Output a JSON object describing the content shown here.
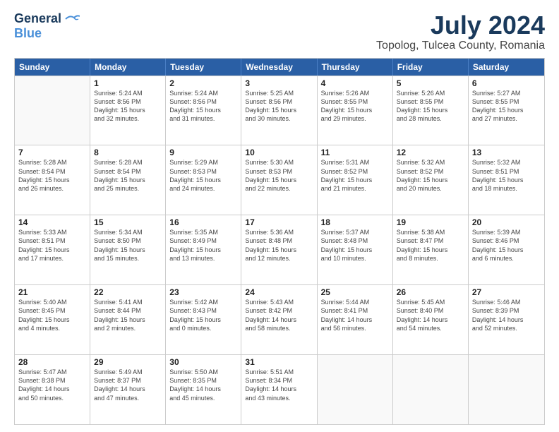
{
  "logo": {
    "line1": "General",
    "line2": "Blue"
  },
  "title": "July 2024",
  "subtitle": "Topolog, Tulcea County, Romania",
  "header": {
    "days": [
      "Sunday",
      "Monday",
      "Tuesday",
      "Wednesday",
      "Thursday",
      "Friday",
      "Saturday"
    ]
  },
  "weeks": [
    [
      {
        "day": "",
        "info": ""
      },
      {
        "day": "1",
        "info": "Sunrise: 5:24 AM\nSunset: 8:56 PM\nDaylight: 15 hours\nand 32 minutes."
      },
      {
        "day": "2",
        "info": "Sunrise: 5:24 AM\nSunset: 8:56 PM\nDaylight: 15 hours\nand 31 minutes."
      },
      {
        "day": "3",
        "info": "Sunrise: 5:25 AM\nSunset: 8:56 PM\nDaylight: 15 hours\nand 30 minutes."
      },
      {
        "day": "4",
        "info": "Sunrise: 5:26 AM\nSunset: 8:55 PM\nDaylight: 15 hours\nand 29 minutes."
      },
      {
        "day": "5",
        "info": "Sunrise: 5:26 AM\nSunset: 8:55 PM\nDaylight: 15 hours\nand 28 minutes."
      },
      {
        "day": "6",
        "info": "Sunrise: 5:27 AM\nSunset: 8:55 PM\nDaylight: 15 hours\nand 27 minutes."
      }
    ],
    [
      {
        "day": "7",
        "info": "Sunrise: 5:28 AM\nSunset: 8:54 PM\nDaylight: 15 hours\nand 26 minutes."
      },
      {
        "day": "8",
        "info": "Sunrise: 5:28 AM\nSunset: 8:54 PM\nDaylight: 15 hours\nand 25 minutes."
      },
      {
        "day": "9",
        "info": "Sunrise: 5:29 AM\nSunset: 8:53 PM\nDaylight: 15 hours\nand 24 minutes."
      },
      {
        "day": "10",
        "info": "Sunrise: 5:30 AM\nSunset: 8:53 PM\nDaylight: 15 hours\nand 22 minutes."
      },
      {
        "day": "11",
        "info": "Sunrise: 5:31 AM\nSunset: 8:52 PM\nDaylight: 15 hours\nand 21 minutes."
      },
      {
        "day": "12",
        "info": "Sunrise: 5:32 AM\nSunset: 8:52 PM\nDaylight: 15 hours\nand 20 minutes."
      },
      {
        "day": "13",
        "info": "Sunrise: 5:32 AM\nSunset: 8:51 PM\nDaylight: 15 hours\nand 18 minutes."
      }
    ],
    [
      {
        "day": "14",
        "info": "Sunrise: 5:33 AM\nSunset: 8:51 PM\nDaylight: 15 hours\nand 17 minutes."
      },
      {
        "day": "15",
        "info": "Sunrise: 5:34 AM\nSunset: 8:50 PM\nDaylight: 15 hours\nand 15 minutes."
      },
      {
        "day": "16",
        "info": "Sunrise: 5:35 AM\nSunset: 8:49 PM\nDaylight: 15 hours\nand 13 minutes."
      },
      {
        "day": "17",
        "info": "Sunrise: 5:36 AM\nSunset: 8:48 PM\nDaylight: 15 hours\nand 12 minutes."
      },
      {
        "day": "18",
        "info": "Sunrise: 5:37 AM\nSunset: 8:48 PM\nDaylight: 15 hours\nand 10 minutes."
      },
      {
        "day": "19",
        "info": "Sunrise: 5:38 AM\nSunset: 8:47 PM\nDaylight: 15 hours\nand 8 minutes."
      },
      {
        "day": "20",
        "info": "Sunrise: 5:39 AM\nSunset: 8:46 PM\nDaylight: 15 hours\nand 6 minutes."
      }
    ],
    [
      {
        "day": "21",
        "info": "Sunrise: 5:40 AM\nSunset: 8:45 PM\nDaylight: 15 hours\nand 4 minutes."
      },
      {
        "day": "22",
        "info": "Sunrise: 5:41 AM\nSunset: 8:44 PM\nDaylight: 15 hours\nand 2 minutes."
      },
      {
        "day": "23",
        "info": "Sunrise: 5:42 AM\nSunset: 8:43 PM\nDaylight: 15 hours\nand 0 minutes."
      },
      {
        "day": "24",
        "info": "Sunrise: 5:43 AM\nSunset: 8:42 PM\nDaylight: 14 hours\nand 58 minutes."
      },
      {
        "day": "25",
        "info": "Sunrise: 5:44 AM\nSunset: 8:41 PM\nDaylight: 14 hours\nand 56 minutes."
      },
      {
        "day": "26",
        "info": "Sunrise: 5:45 AM\nSunset: 8:40 PM\nDaylight: 14 hours\nand 54 minutes."
      },
      {
        "day": "27",
        "info": "Sunrise: 5:46 AM\nSunset: 8:39 PM\nDaylight: 14 hours\nand 52 minutes."
      }
    ],
    [
      {
        "day": "28",
        "info": "Sunrise: 5:47 AM\nSunset: 8:38 PM\nDaylight: 14 hours\nand 50 minutes."
      },
      {
        "day": "29",
        "info": "Sunrise: 5:49 AM\nSunset: 8:37 PM\nDaylight: 14 hours\nand 47 minutes."
      },
      {
        "day": "30",
        "info": "Sunrise: 5:50 AM\nSunset: 8:35 PM\nDaylight: 14 hours\nand 45 minutes."
      },
      {
        "day": "31",
        "info": "Sunrise: 5:51 AM\nSunset: 8:34 PM\nDaylight: 14 hours\nand 43 minutes."
      },
      {
        "day": "",
        "info": ""
      },
      {
        "day": "",
        "info": ""
      },
      {
        "day": "",
        "info": ""
      }
    ]
  ]
}
